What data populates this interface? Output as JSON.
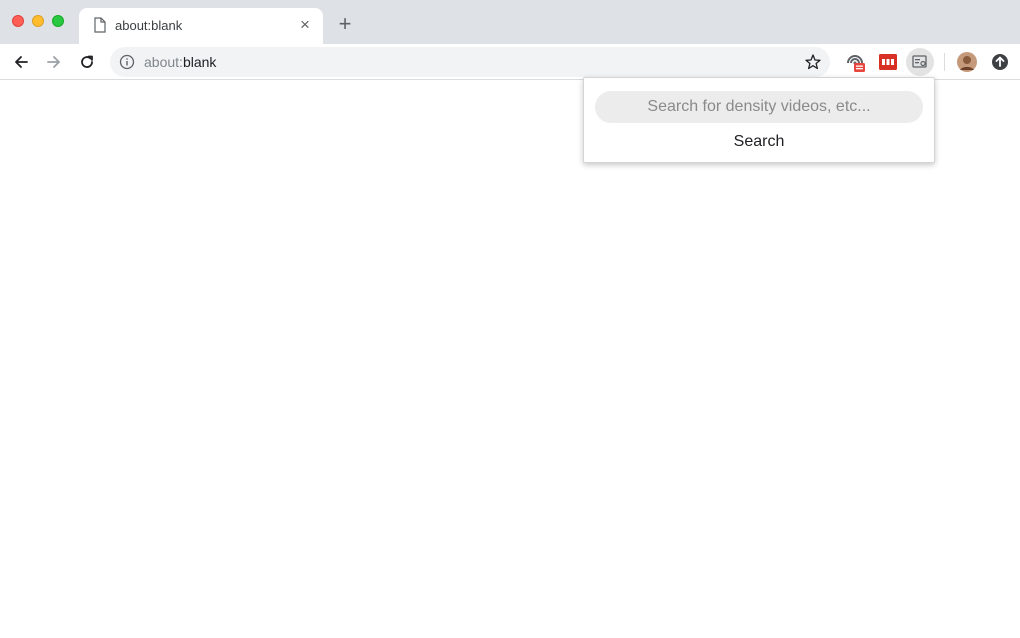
{
  "window": {
    "controls": [
      "close",
      "minimize",
      "zoom"
    ]
  },
  "tab": {
    "title": "about:blank",
    "icon": "page-icon",
    "close_label": "×"
  },
  "newtab": {
    "label": "+"
  },
  "toolbar": {
    "back_icon": "back-arrow-icon",
    "forward_icon": "forward-arrow-icon",
    "reload_icon": "reload-icon",
    "url_scheme": "about:",
    "url_rest": "blank",
    "info_icon": "info-icon",
    "bookmark_icon": "star-icon",
    "extensions": [
      "density-extension-icon",
      "red-extension-icon",
      "video-search-extension-icon"
    ],
    "profile_icon": "avatar",
    "menu_icon": "update-icon"
  },
  "popup": {
    "search_placeholder": "Search for density videos, etc...",
    "search_value": "",
    "button_label": "Search"
  },
  "colors": {
    "tabstrip": "#dee1e6",
    "omnibox": "#f1f3f4",
    "red_ext": "#d93025",
    "avatar": "#a8704f"
  }
}
